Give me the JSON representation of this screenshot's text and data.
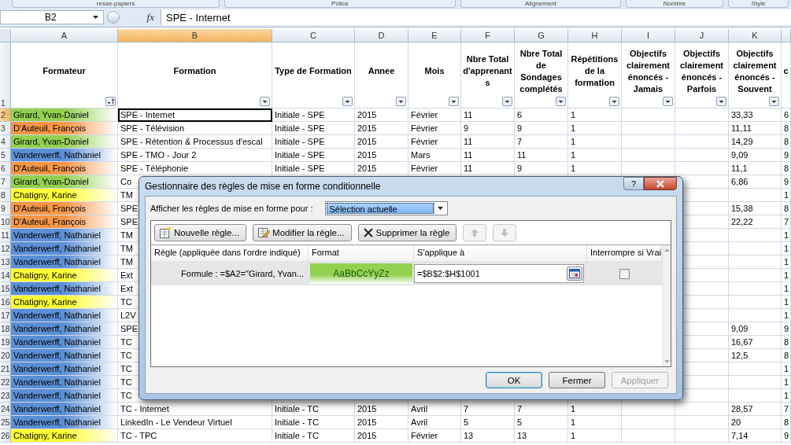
{
  "ribbon_groups": [
    "resse-papiers",
    "Police",
    "Alignement",
    "Nombre",
    "Style"
  ],
  "formula_bar": {
    "name_box": "B2",
    "fx": "fx",
    "content": "SPE - Internet"
  },
  "columns": [
    {
      "letter": "A",
      "header": "Formateur",
      "kind": "sort",
      "selected": false
    },
    {
      "letter": "B",
      "header": "Formation",
      "kind": "dropdown",
      "selected": true
    },
    {
      "letter": "C",
      "header": "Type de Formation",
      "kind": "dropdown",
      "selected": false
    },
    {
      "letter": "D",
      "header": "Annee",
      "kind": "dropdown",
      "selected": false
    },
    {
      "letter": "E",
      "header": "Mois",
      "kind": "dropdown",
      "selected": false
    },
    {
      "letter": "F",
      "header": "Nbre Total d'apprenants",
      "kind": "dropdown",
      "selected": false
    },
    {
      "letter": "G",
      "header": "Nbre Total de Sondages complétés",
      "kind": "dropdown",
      "selected": false
    },
    {
      "letter": "H",
      "header": "Répétitions de la formation",
      "kind": "dropdown",
      "selected": false
    },
    {
      "letter": "I",
      "header": "Objectifs clairement énoncés - Jamais",
      "kind": "dropdown",
      "selected": false
    },
    {
      "letter": "J",
      "header": "Objectifs clairement énoncés - Parfois",
      "kind": "dropdown",
      "selected": false
    },
    {
      "letter": "K",
      "header": "Objectifs clairement énoncés - Souvent",
      "kind": "dropdown",
      "selected": false
    },
    {
      "header": "c",
      "kind": "plain"
    }
  ],
  "header_row_number": "1",
  "rows": [
    {
      "number": "2",
      "selected": true,
      "a": "Girard, Yvan-Daniel",
      "color": "#92d050",
      "b": "SPE - Internet",
      "c": "Initiale - SPE",
      "d": "2015",
      "e": "Février",
      "f": "11",
      "g": "6",
      "h": "1",
      "k": "33,33",
      "l": "6"
    },
    {
      "number": "3",
      "selected": false,
      "a": "D'Auteuil, François",
      "color": "#f79646",
      "b": "SPE - Télévision",
      "c": "Initiale - SPE",
      "d": "2015",
      "e": "Février",
      "f": "9",
      "g": "9",
      "h": "1",
      "k": "11,11",
      "l": "8"
    },
    {
      "number": "4",
      "selected": false,
      "a": "Girard, Yvan-Daniel",
      "color": "#92d050",
      "b": "SPE - Rétention & Processus d'escal",
      "c": "Initiale - SPE",
      "d": "2015",
      "e": "Février",
      "f": "11",
      "g": "7",
      "h": "1",
      "k": "14,29",
      "l": "8"
    },
    {
      "number": "5",
      "selected": false,
      "a": "Vanderwerff, Nathaniel",
      "color": "#5b8fd5",
      "b": "SPE - TMO - Jour 2",
      "c": "Initiale - SPE",
      "d": "2015",
      "e": "Mars",
      "f": "11",
      "g": "11",
      "h": "1",
      "k": "9,09",
      "l": "9"
    },
    {
      "number": "6",
      "selected": false,
      "a": "D'Auteuil, François",
      "color": "#f79646",
      "b": "SPE - Téléphonie",
      "c": "Initiale - SPE",
      "d": "2015",
      "e": "Février",
      "f": "11",
      "g": "9",
      "h": "1",
      "k": "11,1",
      "l": "8"
    },
    {
      "number": "7",
      "selected": false,
      "a": "Girard, Yvan-Daniel",
      "color": "#92d050",
      "b": "Co",
      "k": "6,86",
      "l": "9"
    },
    {
      "number": "8",
      "selected": false,
      "a": "Chatigny, Karine",
      "color": "#ffff33",
      "b": "TM",
      "l": "1"
    },
    {
      "number": "9",
      "selected": false,
      "a": "D'Auteuil, François",
      "color": "#f79646",
      "b": "SPE",
      "k": "15,38",
      "l": "8"
    },
    {
      "number": "10",
      "selected": false,
      "a": "D'Auteuil, François",
      "color": "#f79646",
      "b": "SPE",
      "k": "22,22",
      "l": "7"
    },
    {
      "number": "11",
      "selected": false,
      "a": "Vanderwerff, Nathaniel",
      "color": "#5b8fd5",
      "b": "TM",
      "l": "1"
    },
    {
      "number": "12",
      "selected": false,
      "a": "Vanderwerff, Nathaniel",
      "color": "#5b8fd5",
      "b": "TM",
      "l": "1"
    },
    {
      "number": "13",
      "selected": false,
      "a": "Vanderwerff, Nathaniel",
      "color": "#5b8fd5",
      "b": "TM",
      "l": "1"
    },
    {
      "number": "14",
      "selected": false,
      "a": "Chatigny, Karine",
      "color": "#ffff33",
      "b": "Ext",
      "l": "1"
    },
    {
      "number": "15",
      "selected": false,
      "a": "Vanderwerff, Nathaniel",
      "color": "#5b8fd5",
      "b": "Ext",
      "l": "1"
    },
    {
      "number": "16",
      "selected": false,
      "a": "Chatigny, Karine",
      "color": "#ffff33",
      "b": "TC",
      "l": "1"
    },
    {
      "number": "17",
      "selected": false,
      "a": "Vanderwerff, Nathaniel",
      "color": "#5b8fd5",
      "b": "L2V",
      "l": "1"
    },
    {
      "number": "18",
      "selected": false,
      "a": "Vanderwerff, Nathaniel",
      "color": "#5b8fd5",
      "b": "SPE",
      "k": "9,09",
      "l": "9"
    },
    {
      "number": "19",
      "selected": false,
      "a": "Vanderwerff, Nathaniel",
      "color": "#5b8fd5",
      "b": "TC",
      "k": "16,67",
      "l": "8"
    },
    {
      "number": "20",
      "selected": false,
      "a": "Vanderwerff, Nathaniel",
      "color": "#5b8fd5",
      "b": "TC",
      "k": "12,5",
      "l": "8"
    },
    {
      "number": "21",
      "selected": false,
      "a": "Vanderwerff, Nathaniel",
      "color": "#5b8fd5",
      "b": "TC",
      "l": "1"
    },
    {
      "number": "22",
      "selected": false,
      "a": "Vanderwerff, Nathaniel",
      "color": "#5b8fd5",
      "b": "TC",
      "l": "1"
    },
    {
      "number": "23",
      "selected": false,
      "a": "Vanderwerff, Nathaniel",
      "color": "#5b8fd5",
      "b": "TC",
      "l": "1"
    },
    {
      "number": "24",
      "selected": false,
      "a": "Vanderwerff, Nathaniel",
      "color": "#5b8fd5",
      "b": "TC - Internet",
      "c": "Initiale - TC",
      "d": "2015",
      "e": "Avril",
      "f": "7",
      "g": "7",
      "h": "1",
      "k": "28,57",
      "l": "7"
    },
    {
      "number": "25",
      "selected": false,
      "a": "Vanderwerff, Nathaniel",
      "color": "#5b8fd5",
      "b": "LinkedIn - Le Vendeur Virtuel",
      "c": "Initiale - TC",
      "d": "2015",
      "e": "Avril",
      "f": "5",
      "g": "5",
      "h": "1",
      "k": "20",
      "l": "8"
    },
    {
      "number": "26",
      "selected": false,
      "a": "Chatigny, Karine",
      "color": "#ffff33",
      "b": "TC - TPC",
      "c": "Initiale - TC",
      "d": "2015",
      "e": "Février",
      "f": "13",
      "g": "13",
      "h": "1",
      "k": "7,14",
      "l": "9"
    }
  ],
  "dialog": {
    "title": "Gestionnaire des règles de mise en forme conditionnelle",
    "help": "?",
    "show_label": "Afficher les règles de mise en forme pour :",
    "scope": "Sélection actuelle",
    "toolbar": [
      {
        "kind": "new",
        "label": "Nouvelle règle...",
        "disabled": false
      },
      {
        "kind": "edit",
        "label": "Modifier la règle...",
        "disabled": false
      },
      {
        "kind": "delete",
        "label": "Supprimer la règle",
        "disabled": false
      },
      {
        "kind": "up",
        "disabled": true
      },
      {
        "kind": "down",
        "disabled": true
      }
    ],
    "list_columns": [
      "Règle (appliquée dans l'ordre indiqué)",
      "Format",
      "S'applique à",
      "Interrompre si Vrai"
    ],
    "rules": [
      {
        "rule": "Formule : =$A2=\"Girard, Yvan...",
        "preview": "AaBbCcYyZz",
        "color": "#92d050",
        "applies_to": "=$B$2:$H$1001",
        "stop_if_true": false,
        "selected": true
      }
    ],
    "buttons": [
      {
        "label": "OK",
        "default": true,
        "disabled": false
      },
      {
        "label": "Fermer",
        "default": false,
        "disabled": false
      },
      {
        "label": "Appliquer",
        "default": false,
        "disabled": true
      }
    ]
  }
}
